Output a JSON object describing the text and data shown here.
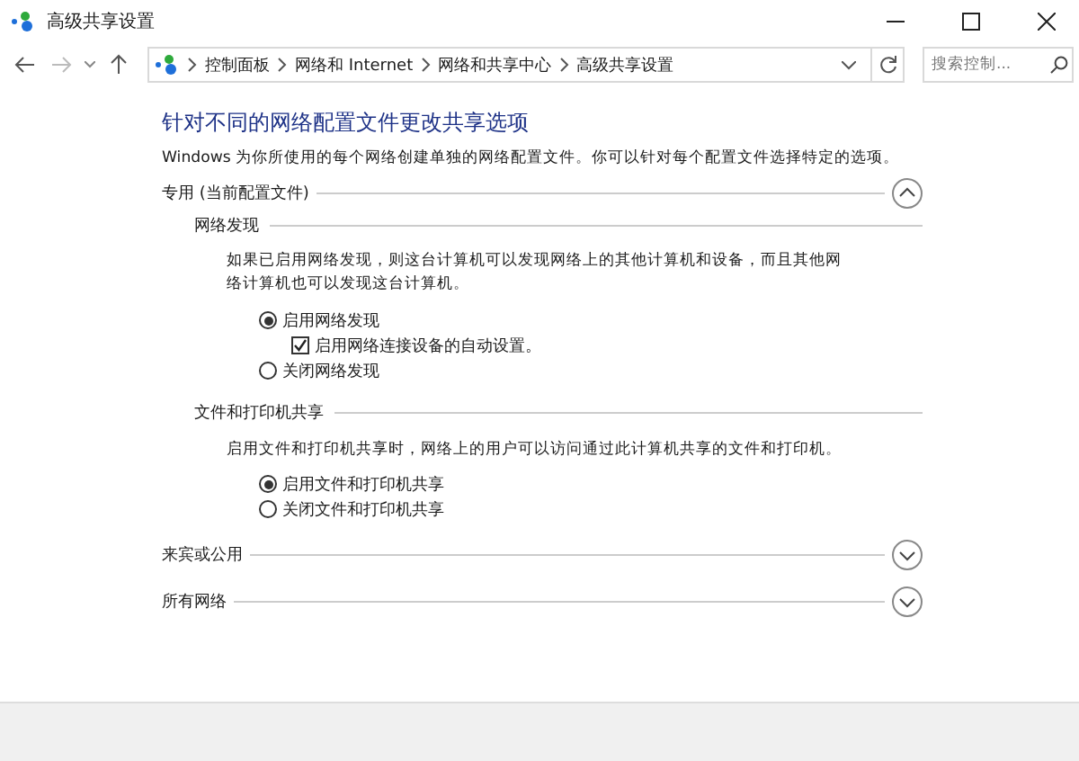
{
  "window": {
    "title": "高级共享设置"
  },
  "address_bar": {
    "breadcrumbs": [
      "控制面板",
      "网络和 Internet",
      "网络和共享中心",
      "高级共享设置"
    ],
    "search": {
      "placeholder": "搜索控制..."
    }
  },
  "heading": "针对不同的网络配置文件更改共享选项",
  "description": "Windows 为你所使用的每个网络创建单独的网络配置文件。你可以针对每个配置文件选择特定的选项。",
  "profiles": [
    {
      "label": "专用 (当前配置文件)",
      "expanded": true,
      "groups": [
        {
          "title": "网络发现",
          "description": "如果已启用网络发现，则这台计算机可以发现网络上的其他计算机和设备，而且其他网络计算机也可以发现这台计算机。",
          "options": [
            {
              "kind": "radio",
              "label": "启用网络发现",
              "selected": true
            },
            {
              "kind": "checkbox",
              "label": "启用网络连接设备的自动设置。",
              "checked": true
            },
            {
              "kind": "radio",
              "label": "关闭网络发现",
              "selected": false
            }
          ]
        },
        {
          "title": "文件和打印机共享",
          "description": "启用文件和打印机共享时，网络上的用户可以访问通过此计算机共享的文件和打印机。",
          "options": [
            {
              "kind": "radio",
              "label": "启用文件和打印机共享",
              "selected": true
            },
            {
              "kind": "radio",
              "label": "关闭文件和打印机共享",
              "selected": false
            }
          ]
        }
      ]
    },
    {
      "label": "来宾或公用",
      "expanded": false
    },
    {
      "label": "所有网络",
      "expanded": false
    }
  ]
}
